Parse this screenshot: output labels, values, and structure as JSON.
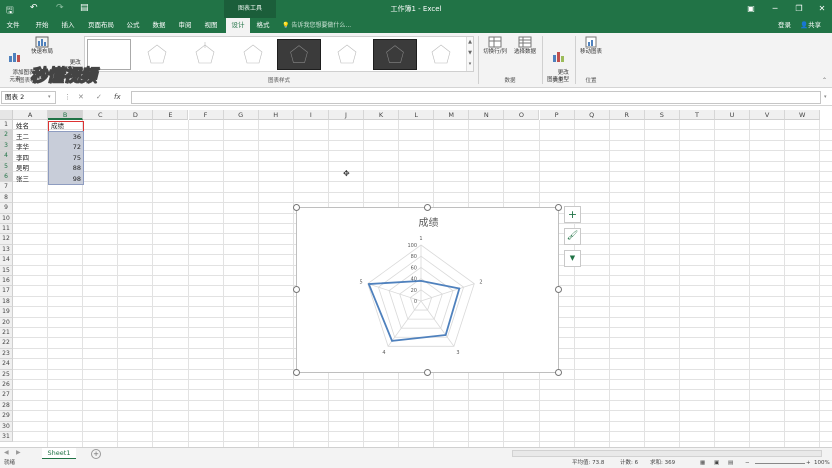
{
  "title_bar": {
    "context_tab": "图表工具",
    "window_title": "工作簿1 - Excel"
  },
  "tabs": [
    {
      "label": "文件"
    },
    {
      "label": "开始"
    },
    {
      "label": "插入"
    },
    {
      "label": "页面布局"
    },
    {
      "label": "公式"
    },
    {
      "label": "数据"
    },
    {
      "label": "审阅"
    },
    {
      "label": "视图"
    },
    {
      "label": "设计",
      "active": true
    },
    {
      "label": "格式"
    }
  ],
  "tell_me": "告诉我您想要做什么...",
  "login": "登录",
  "share": "共享",
  "ribbon": {
    "add_chart_element": "添加图表\n元素",
    "quick_layout": "快速布局",
    "change_colors": "更改\n颜色",
    "group_layout": "图表布局",
    "group_styles": "图表样式",
    "switch_row_col": "切换行/列",
    "select_data": "选择数据",
    "group_data": "数据",
    "change_type": "更改\n图表类型",
    "group_type": "类型",
    "move_chart": "移动图表",
    "group_location": "位置"
  },
  "watermark": "秒懂视频",
  "formula_bar": {
    "name_box": "图表 2",
    "cancel": "✕",
    "enter": "✓",
    "fx": "fx",
    "value": ""
  },
  "columns": [
    "A",
    "B",
    "C",
    "D",
    "E",
    "F",
    "G",
    "H",
    "I",
    "J",
    "K",
    "L",
    "M",
    "N",
    "O",
    "P",
    "Q",
    "R",
    "S",
    "T",
    "U",
    "V",
    "W"
  ],
  "rows": [
    "1",
    "2",
    "3",
    "4",
    "5",
    "6",
    "7",
    "8",
    "9",
    "10",
    "11",
    "12",
    "13",
    "14",
    "15",
    "16",
    "17",
    "18",
    "19",
    "20",
    "21",
    "22",
    "23",
    "24",
    "25",
    "26",
    "27",
    "28",
    "29",
    "30",
    "31"
  ],
  "table": {
    "header": {
      "name": "姓名",
      "score": "成绩"
    },
    "rows": [
      {
        "name": "王二",
        "score": "36"
      },
      {
        "name": "李华",
        "score": "72"
      },
      {
        "name": "李四",
        "score": "75"
      },
      {
        "name": "吴明",
        "score": "88"
      },
      {
        "name": "张三",
        "score": "98"
      }
    ]
  },
  "chart_data": {
    "type": "radar",
    "title": "成绩",
    "categories": [
      "1",
      "2",
      "3",
      "4",
      "5"
    ],
    "series": [
      {
        "values": [
          36,
          72,
          75,
          88,
          98
        ],
        "color": "#4f81bd"
      }
    ],
    "axis_ticks": [
      "0",
      "20",
      "40",
      "60",
      "80",
      "100"
    ],
    "range": [
      0,
      100
    ],
    "legend": false
  },
  "chart_side_buttons": {
    "elements": "+",
    "styles": "🖌",
    "filter": "▼"
  },
  "sheet": {
    "tab": "Sheet1",
    "add": "+"
  },
  "status_bar": {
    "ready": "就绪",
    "average": "平均值: 73.8",
    "count": "计数: 6",
    "sum": "求和: 369",
    "zoom": "100%"
  },
  "colors": {
    "excel_green": "#217346",
    "series": "#4f81bd"
  }
}
